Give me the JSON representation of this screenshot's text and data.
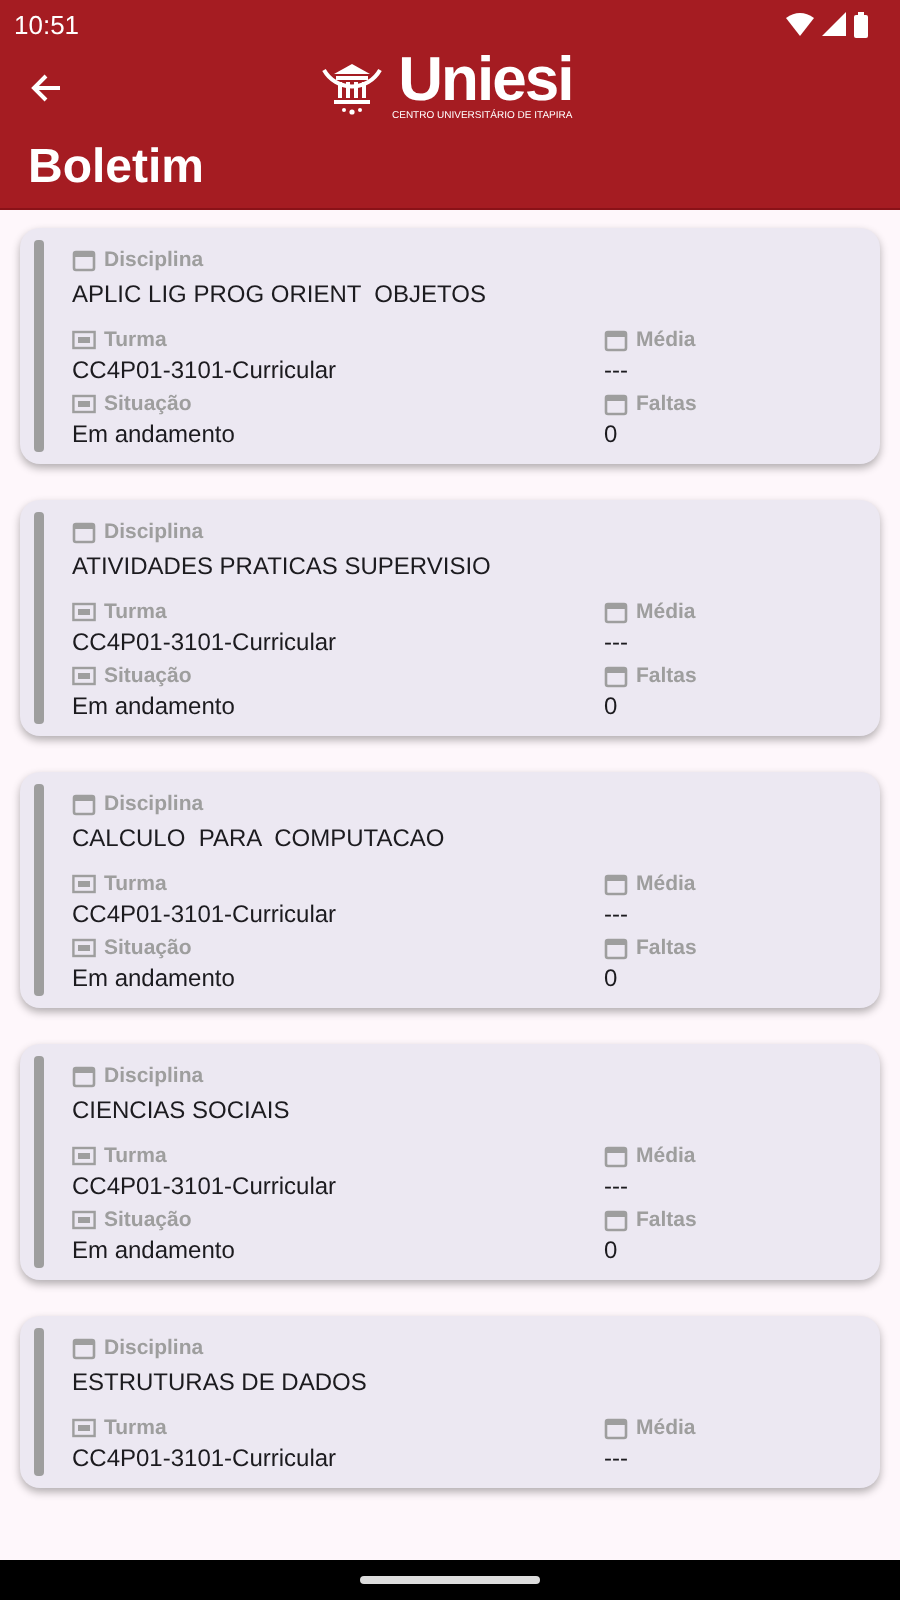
{
  "status_bar": {
    "time": "10:51"
  },
  "header": {
    "logo": {
      "name": "Uniesi",
      "subtitle": "CENTRO UNIVERSITÁRIO DE ITAPIRA"
    },
    "title": "Boletim"
  },
  "cards": [
    {
      "disciplina": {
        "label": "Disciplina",
        "value": "APLIC LIG PROG ORIENT  OBJETOS"
      },
      "turma": {
        "label": "Turma",
        "value": "CC4P01-3101-Curricular"
      },
      "media": {
        "label": "Média",
        "value": "---"
      },
      "situacao": {
        "label": "Situação",
        "value": "Em andamento"
      },
      "faltas": {
        "label": "Faltas",
        "value": "0"
      }
    },
    {
      "disciplina": {
        "label": "Disciplina",
        "value": "ATIVIDADES PRATICAS SUPERVISIO"
      },
      "turma": {
        "label": "Turma",
        "value": "CC4P01-3101-Curricular"
      },
      "media": {
        "label": "Média",
        "value": "---"
      },
      "situacao": {
        "label": "Situação",
        "value": "Em andamento"
      },
      "faltas": {
        "label": "Faltas",
        "value": "0"
      }
    },
    {
      "disciplina": {
        "label": "Disciplina",
        "value": "CALCULO  PARA  COMPUTACAO"
      },
      "turma": {
        "label": "Turma",
        "value": "CC4P01-3101-Curricular"
      },
      "media": {
        "label": "Média",
        "value": "---"
      },
      "situacao": {
        "label": "Situação",
        "value": "Em andamento"
      },
      "faltas": {
        "label": "Faltas",
        "value": "0"
      }
    },
    {
      "disciplina": {
        "label": "Disciplina",
        "value": "CIENCIAS SOCIAIS"
      },
      "turma": {
        "label": "Turma",
        "value": "CC4P01-3101-Curricular"
      },
      "media": {
        "label": "Média",
        "value": "---"
      },
      "situacao": {
        "label": "Situação",
        "value": "Em andamento"
      },
      "faltas": {
        "label": "Faltas",
        "value": "0"
      }
    },
    {
      "disciplina": {
        "label": "Disciplina",
        "value": "ESTRUTURAS DE DADOS"
      },
      "turma": {
        "label": "Turma",
        "value": "CC4P01-3101-Curricular"
      },
      "media": {
        "label": "Média",
        "value": "---"
      }
    }
  ]
}
